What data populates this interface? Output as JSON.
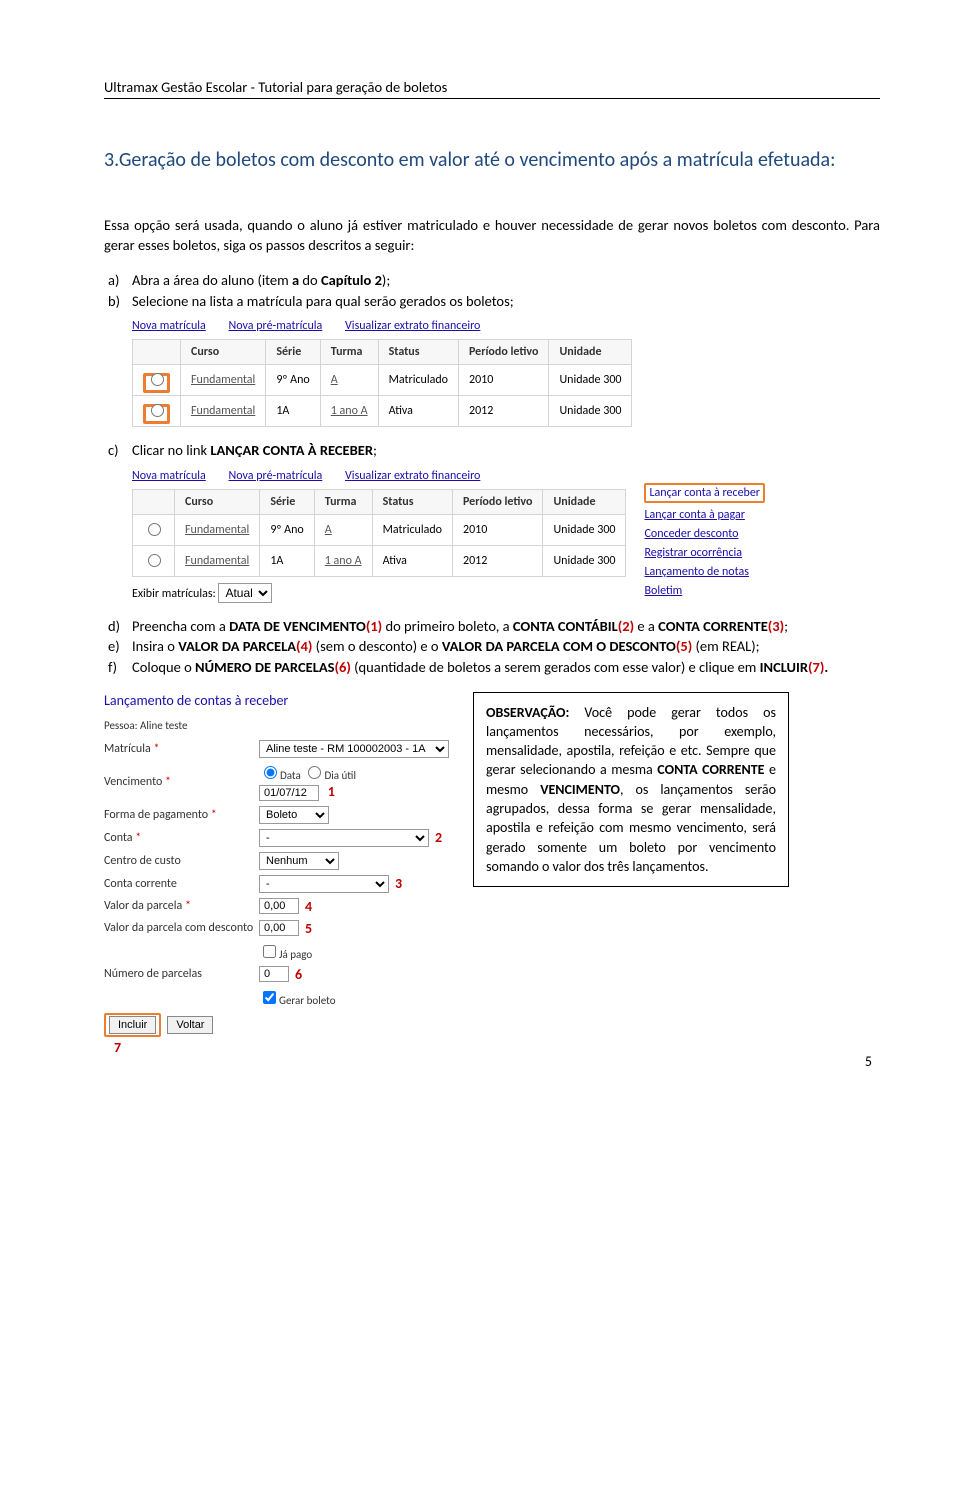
{
  "header": "Ultramax Gestão Escolar - Tutorial para geração de boletos",
  "section_title": "3.Geração de boletos com desconto em valor até o vencimento após a matrícula efetuada:",
  "intro_para": "Essa opção será usada, quando o aluno já estiver matriculado e houver necessidade de gerar novos boletos com desconto. Para gerar esses boletos, siga os passos descritos a seguir:",
  "steps": {
    "a_pre": "Abra a área do aluno (item ",
    "a_bold": "a",
    "a_post": " do ",
    "a_bold2": "Capítulo 2",
    "a_end": ");",
    "b": "Selecione na lista a matrícula para qual serão gerados os boletos;",
    "c_pre": "Clicar no link ",
    "c_bold": "LANÇAR CONTA À RECEBER",
    "c_end": ";",
    "d_pre": "Preencha com a ",
    "d_b1": "DATA DE VENCIMENTO",
    "d_r1": "(1)",
    "d_mid1": " do primeiro boleto, a ",
    "d_b2": "CONTA CONTÁBIL",
    "d_r2": "(2)",
    "d_mid2": " e a ",
    "d_b3": "CONTA CORRENTE",
    "d_r3": "(3)",
    "d_end": ";",
    "e_pre": "Insira o ",
    "e_b1": "VALOR DA PARCELA",
    "e_r1": "(4)",
    "e_mid1": " (sem o desconto) e o ",
    "e_b2": "VALOR DA PARCELA COM O DESCONTO",
    "e_r2": "(5)",
    "e_end": " (em REAL);",
    "f_pre": "Coloque o ",
    "f_b1": "NÚMERO DE PARCELAS",
    "f_r1": "(6)",
    "f_mid": " (quantidade de boletos a serem gerados com esse valor) e clique em ",
    "f_b2": "INCLUIR",
    "f_r2": "(7)",
    "f_end": "."
  },
  "screenshot1": {
    "links": [
      "Nova matrícula",
      "Nova pré-matrícula",
      "Visualizar extrato financeiro"
    ],
    "cols": [
      "Curso",
      "Série",
      "Turma",
      "Status",
      "Período letivo",
      "Unidade"
    ],
    "rows": [
      {
        "curso": "Fundamental",
        "serie": "9º Ano",
        "turma": "A",
        "status": "Matriculado",
        "periodo": "2010",
        "unidade": "Unidade 300"
      },
      {
        "curso": "Fundamental",
        "serie": "1A",
        "turma": "1 ano A",
        "status": "Ativa",
        "periodo": "2012",
        "unidade": "Unidade 300"
      }
    ]
  },
  "screenshot2": {
    "links": [
      "Nova matrícula",
      "Nova pré-matrícula",
      "Visualizar extrato financeiro"
    ],
    "cols": [
      "Curso",
      "Série",
      "Turma",
      "Status",
      "Período letivo",
      "Unidade"
    ],
    "rows": [
      {
        "curso": "Fundamental",
        "serie": "9º Ano",
        "turma": "A",
        "status": "Matriculado",
        "periodo": "2010",
        "unidade": "Unidade 300"
      },
      {
        "curso": "Fundamental",
        "serie": "1A",
        "turma": "1 ano A",
        "status": "Ativa",
        "periodo": "2012",
        "unidade": "Unidade 300"
      }
    ],
    "side": [
      "Lançar conta à receber",
      "Lançar conta à pagar",
      "Conceder desconto",
      "Registrar ocorrência",
      "Lançamento de notas",
      "Boletim"
    ],
    "exibir_label": "Exibir matrículas:",
    "exibir_value": "Atual"
  },
  "form": {
    "title": "Lançamento de contas à receber",
    "pessoa_label": "Pessoa: Aline teste",
    "matricula_label": "Matrícula",
    "matricula_value": "Aline teste - RM 100002003 - 1A",
    "vencimento_label": "Vencimento",
    "vencimento_radio1": "Data",
    "vencimento_radio2": "Dia útil",
    "vencimento_value": "01/07/12",
    "forma_label": "Forma de pagamento",
    "forma_value": "Boleto",
    "conta_label": "Conta",
    "conta_value": "-",
    "centro_label": "Centro de custo",
    "centro_value": "Nenhum",
    "contacorr_label": "Conta corrente",
    "contacorr_value": "-",
    "valorparc_label": "Valor da parcela",
    "valorparc_value": "0,00",
    "valordesc_label": "Valor da parcela com desconto",
    "valordesc_value": "0,00",
    "japago_label": "Já pago",
    "numparc_label": "Número de parcelas",
    "numparc_value": "0",
    "gerarboleto_label": "Gerar boleto",
    "incluir": "Incluir",
    "voltar": "Voltar",
    "m1": "1",
    "m2": "2",
    "m3": "3",
    "m4": "4",
    "m5": "5",
    "m6": "6",
    "m7": "7"
  },
  "obs": {
    "title": "OBSERVAÇÃO:",
    "p1_pre": " Você pode gerar todos os lançamentos necessários, por exemplo, mensalidade, apostila, refeição e etc. Sempre que gerar selecionando a mesma ",
    "p1_b1": "CONTA CORRENTE",
    "p1_mid1": " e mesmo ",
    "p1_b2": "VENCIMENTO",
    "p1_post": ", os lançamentos serão agrupados, dessa forma se gerar mensalidade, apostila e refeição com mesmo vencimento, será gerado somente um boleto por vencimento somando o valor dos três lançamentos."
  },
  "page_num": "5"
}
